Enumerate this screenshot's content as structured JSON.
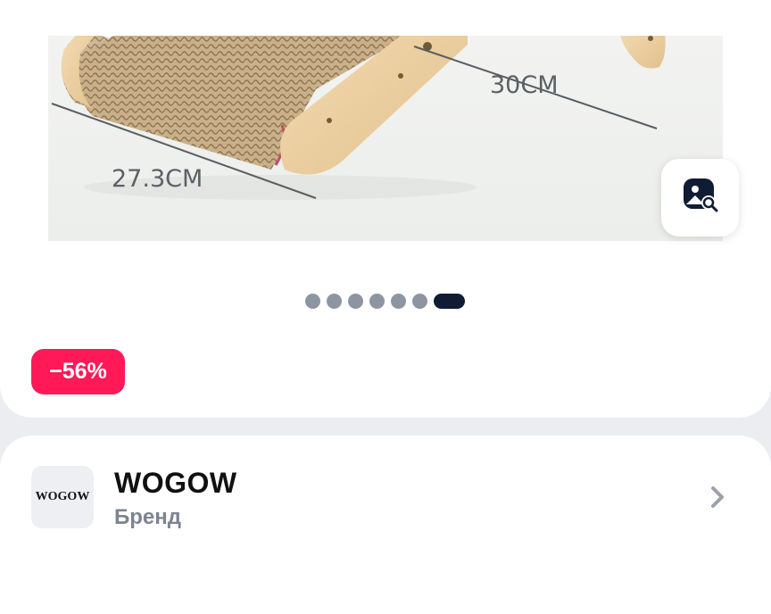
{
  "product": {
    "dimensions": {
      "length_label": "30CM",
      "width_label": "27.3CM"
    },
    "image_search_icon": "image-search-icon",
    "gallery": {
      "total": 7,
      "active_index": 6
    },
    "discount": "−56%"
  },
  "brand": {
    "logo_text": "WOGOW",
    "name": "WOGOW",
    "subtitle": "Бренд",
    "chevron_icon": "chevron-right-icon"
  },
  "colors": {
    "discount": "#ff1a57",
    "pager_active": "#101c33",
    "pager_inactive": "#8d96a0"
  }
}
